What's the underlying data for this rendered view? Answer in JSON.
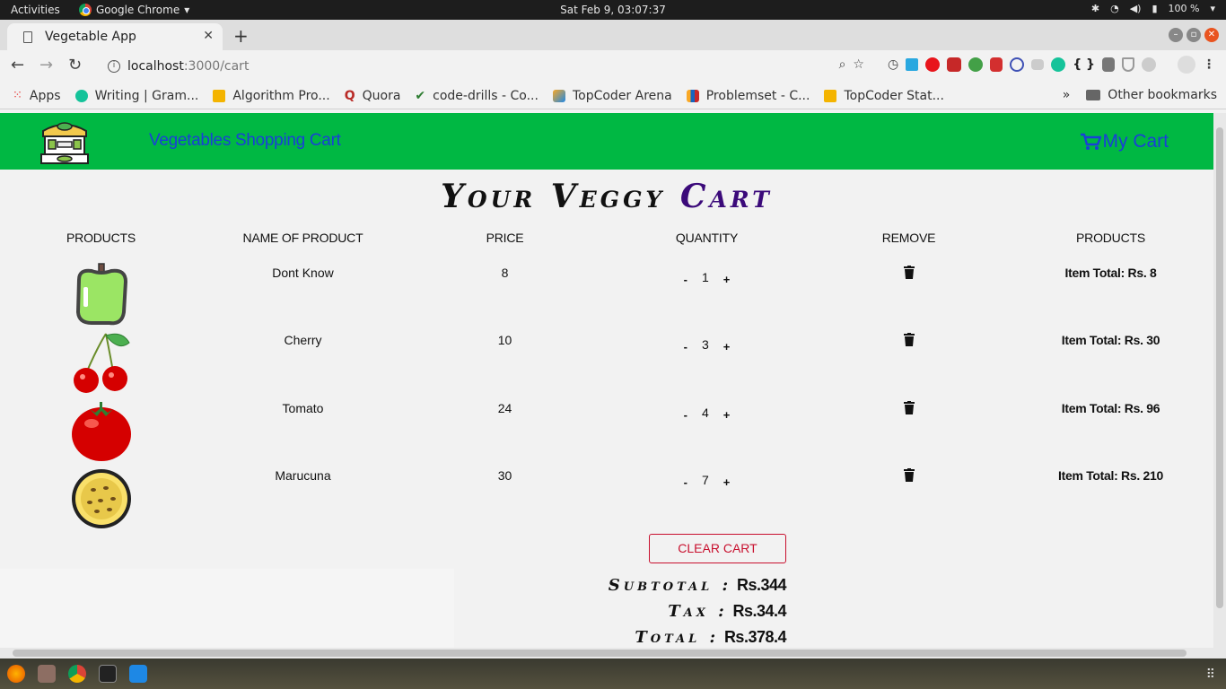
{
  "system": {
    "activities": "Activities",
    "app_name": "Google Chrome",
    "clock": "Sat Feb  9, 03:07:37",
    "battery": "100 %"
  },
  "browser": {
    "tab_title": "Vegetable App",
    "url_host": "localhost",
    "url_path": ":3000/cart",
    "bookmarks": [
      {
        "label": "Apps",
        "color": "#e53935"
      },
      {
        "label": "Writing | Gram...",
        "color": "#15c39a"
      },
      {
        "label": "Algorithm Pro...",
        "color": "#f4b400"
      },
      {
        "label": "Quora",
        "color": "#b92b27"
      },
      {
        "label": "code-drills - Co...",
        "color": "#2e7d32"
      },
      {
        "label": "TopCoder Arena",
        "color": "#f9a825"
      },
      {
        "label": "Problemset - C...",
        "color": "#1565c0"
      },
      {
        "label": "TopCoder Stat...",
        "color": "#f4b400"
      }
    ],
    "bookmarks_more": "»",
    "other_bookmarks": "Other bookmarks"
  },
  "navbar": {
    "brand": "Vegetables Shopping Cart",
    "cart_label": "My Cart",
    "bg_color": "#00b843",
    "link_color": "#1a3fd8"
  },
  "cart": {
    "title_part1": "Your Veggy",
    "title_part2": "Cart",
    "headers": [
      "PRODUCTS",
      "NAME OF PRODUCT",
      "PRICE",
      "QUANTITY",
      "REMOVE",
      "PRODUCTS"
    ],
    "items": [
      {
        "image": "green-pepper",
        "name": "Dont Know",
        "price": "8",
        "decrement": "-",
        "quantity": "1",
        "increment": "+",
        "total": "Item Total: Rs. 8"
      },
      {
        "image": "cherry",
        "name": "Cherry",
        "price": "10",
        "decrement": "-",
        "quantity": "3",
        "increment": "+",
        "total": "Item Total: Rs. 30"
      },
      {
        "image": "tomato",
        "name": "Tomato",
        "price": "24",
        "decrement": "-",
        "quantity": "4",
        "increment": "+",
        "total": "Item Total: Rs. 96"
      },
      {
        "image": "passion-fruit",
        "name": "Marucuna",
        "price": "30",
        "decrement": "-",
        "quantity": "7",
        "increment": "+",
        "total": "Item Total: Rs. 210"
      }
    ],
    "clear_label": "CLEAR CART",
    "subtotal_label": "Subtotal :",
    "subtotal_value": "Rs.344",
    "tax_label": "Tax :",
    "tax_value": "Rs.34.4",
    "total_label": "Total :",
    "total_value": "Rs.378.4",
    "danger_color": "#c8102e"
  }
}
